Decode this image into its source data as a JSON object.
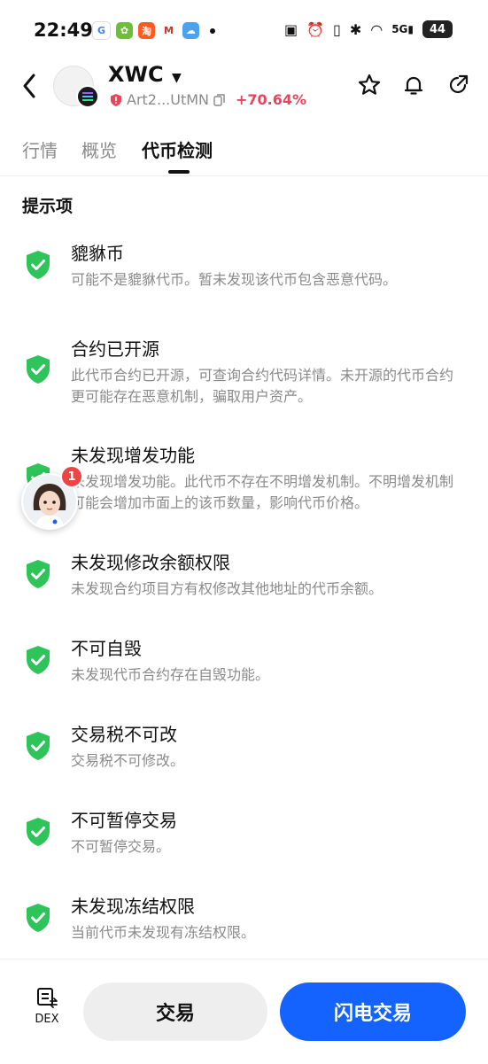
{
  "status_bar": {
    "time": "22:49",
    "app_icons": [
      "google-app-icon",
      "game-app-icon",
      "taobao-app-icon",
      "gmail-app-icon",
      "weather-app-icon"
    ],
    "network_label": "5G",
    "battery": "44"
  },
  "header": {
    "coin_name": "XWC",
    "contract_address": "Art2...UtMN",
    "change_percent": "+70.64%",
    "change_color": "#e8445c"
  },
  "tabs": [
    {
      "label": "行情"
    },
    {
      "label": "概览"
    },
    {
      "label": "代币检测"
    }
  ],
  "section_title": "提示项",
  "check_items": [
    {
      "title": "貔貅币",
      "desc": "可能不是貔貅代币。暂未发现该代币包含恶意代码。"
    },
    {
      "title": "合约已开源",
      "desc": "此代币合约已开源，可查询合约代码详情。未开源的代币合约更可能存在恶意机制，骗取用户资产。"
    },
    {
      "title": "未发现增发功能",
      "desc": "未发现增发功能。此代币不存在不明增发机制。不明增发机制可能会增加市面上的该币数量，影响代币价格。"
    },
    {
      "title": "未发现修改余额权限",
      "desc": "未发现合约项目方有权修改其他地址的代币余额。"
    },
    {
      "title": "不可自毁",
      "desc": "未发现代币合约存在自毁功能。"
    },
    {
      "title": "交易税不可改",
      "desc": "交易税不可修改。"
    },
    {
      "title": "不可暂停交易",
      "desc": "不可暂停交易。"
    },
    {
      "title": "未发现冻结权限",
      "desc": "当前代币未发现有冻结权限。"
    }
  ],
  "floating_assistant": {
    "badge_count": "1"
  },
  "bottom_bar": {
    "dex_label": "DEX",
    "trade_label": "交易",
    "flash_trade_label": "闪电交易",
    "accent_color": "#1463ff"
  }
}
